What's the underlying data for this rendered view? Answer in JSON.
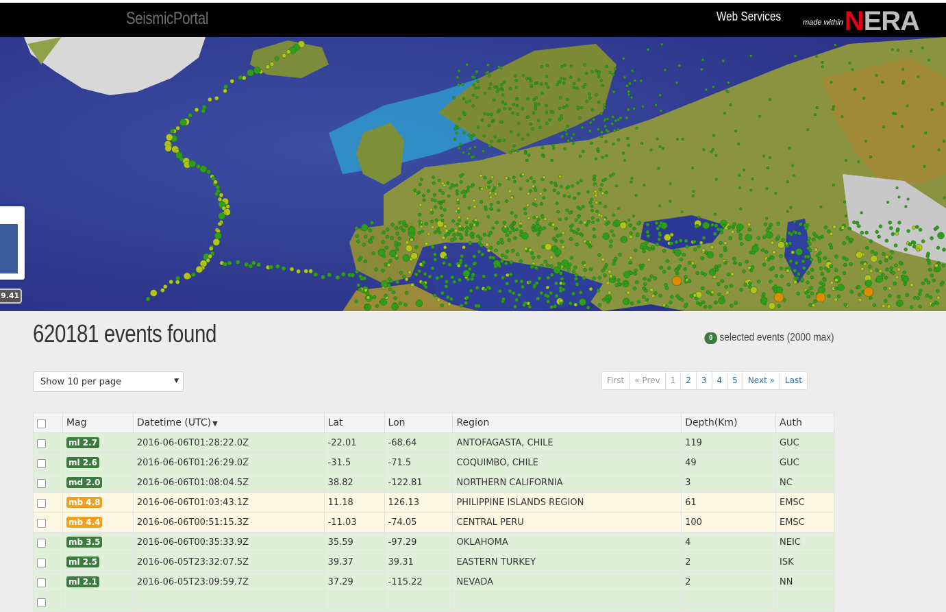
{
  "navbar": {
    "brand": "SeismicPortal",
    "web_services": "Web Services",
    "made_within": "made within",
    "nera_n": "N",
    "nera_rest": "ERA"
  },
  "map": {
    "coord_badge": "9.41",
    "marker_color": "#2e9e1a",
    "marker_color_large": "#b5c21a",
    "marker_color_xl": "#e08a00"
  },
  "results": {
    "count_text": "620181 events found",
    "selected_count": "0",
    "selected_text": "selected events (2000 max)"
  },
  "controls": {
    "per_page": "Show 10 per page",
    "pager": [
      "First",
      "« Prev",
      "1",
      "2",
      "3",
      "4",
      "5",
      "Next »",
      "Last"
    ]
  },
  "table": {
    "headers": [
      "",
      "Mag",
      "Datetime (UTC)",
      "Lat",
      "Lon",
      "Region",
      "Depth(Km)",
      "Auth"
    ],
    "rows": [
      {
        "mag": "ml 2.7",
        "datetime": "2016-06-06T01:28:22.0Z",
        "lat": "-22.01",
        "lon": "-68.64",
        "region": "ANTOFAGASTA, CHILE",
        "depth": "119",
        "auth": "GUC",
        "level": "green"
      },
      {
        "mag": "ml 2.6",
        "datetime": "2016-06-06T01:26:29.0Z",
        "lat": "-31.5",
        "lon": "-71.5",
        "region": "COQUIMBO, CHILE",
        "depth": "49",
        "auth": "GUC",
        "level": "green"
      },
      {
        "mag": "md 2.0",
        "datetime": "2016-06-06T01:08:04.5Z",
        "lat": "38.82",
        "lon": "-122.81",
        "region": "NORTHERN CALIFORNIA",
        "depth": "3",
        "auth": "NC",
        "level": "green"
      },
      {
        "mag": "mb 4.8",
        "datetime": "2016-06-06T01:03:43.1Z",
        "lat": "11.18",
        "lon": "126.13",
        "region": "PHILIPPINE ISLANDS REGION",
        "depth": "61",
        "auth": "EMSC",
        "level": "yellow"
      },
      {
        "mag": "mb 4.4",
        "datetime": "2016-06-06T00:51:15.3Z",
        "lat": "-11.03",
        "lon": "-74.05",
        "region": "CENTRAL PERU",
        "depth": "100",
        "auth": "EMSC",
        "level": "yellow"
      },
      {
        "mag": "mb 3.5",
        "datetime": "2016-06-06T00:35:33.9Z",
        "lat": "35.59",
        "lon": "-97.29",
        "region": "OKLAHOMA",
        "depth": "4",
        "auth": "NEIC",
        "level": "green"
      },
      {
        "mag": "ml 2.5",
        "datetime": "2016-06-05T23:32:07.5Z",
        "lat": "39.37",
        "lon": "39.31",
        "region": "EASTERN TURKEY",
        "depth": "2",
        "auth": "ISK",
        "level": "green"
      },
      {
        "mag": "ml 2.1",
        "datetime": "2016-06-05T23:09:59.7Z",
        "lat": "37.29",
        "lon": "-115.22",
        "region": "NEVADA",
        "depth": "2",
        "auth": "NN",
        "level": "green"
      },
      {
        "mag": "",
        "datetime": "",
        "lat": "",
        "lon": "",
        "region": "",
        "depth": "",
        "auth": "",
        "level": "green"
      }
    ]
  }
}
